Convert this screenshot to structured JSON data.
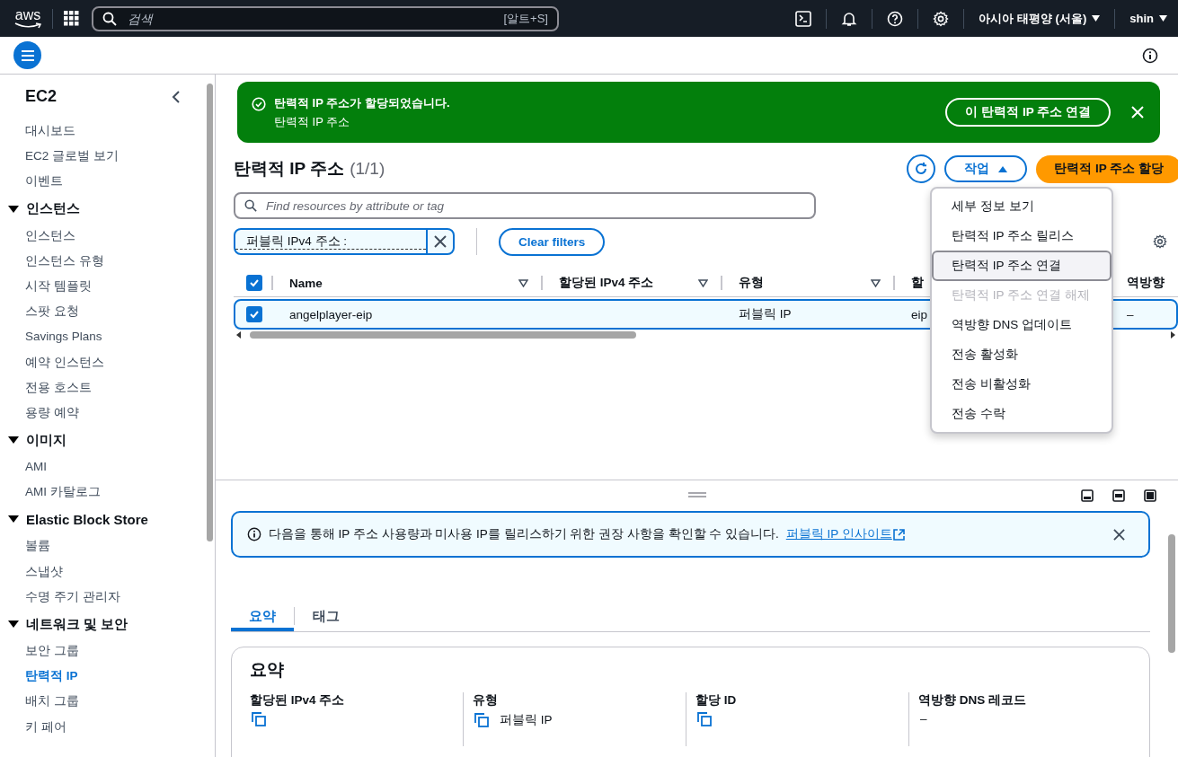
{
  "topnav": {
    "logo": "aws",
    "search": {
      "placeholder": "검색",
      "shortcut": "[알트+S]"
    },
    "region": "아시아 태평양 (서울)",
    "user": "shin"
  },
  "sidebar": {
    "title": "EC2",
    "items": [
      {
        "label": "대시보드",
        "selected": false
      },
      {
        "label": "EC2 글로벌 보기",
        "selected": false
      },
      {
        "label": "이벤트",
        "selected": false
      }
    ],
    "sections": [
      {
        "title": "인스턴스",
        "expanded": true,
        "items": [
          {
            "label": "인스턴스",
            "selected": false
          },
          {
            "label": "인스턴스 유형",
            "selected": false
          },
          {
            "label": "시작 템플릿",
            "selected": false
          },
          {
            "label": "스팟 요청",
            "selected": false
          },
          {
            "label": "Savings Plans",
            "selected": false
          },
          {
            "label": "예약 인스턴스",
            "selected": false
          },
          {
            "label": "전용 호스트",
            "selected": false
          },
          {
            "label": "용량 예약",
            "selected": false
          }
        ]
      },
      {
        "title": "이미지",
        "expanded": true,
        "items": [
          {
            "label": "AMI",
            "selected": false
          },
          {
            "label": "AMI 카탈로그",
            "selected": false
          }
        ]
      },
      {
        "title": "Elastic Block Store",
        "expanded": true,
        "items": [
          {
            "label": "볼륨",
            "selected": false
          },
          {
            "label": "스냅샷",
            "selected": false
          },
          {
            "label": "수명 주기 관리자",
            "selected": false
          }
        ]
      },
      {
        "title": "네트워크 및 보안",
        "expanded": true,
        "items": [
          {
            "label": "보안 그룹",
            "selected": false
          },
          {
            "label": "탄력적 IP",
            "selected": true
          },
          {
            "label": "배치 그룹",
            "selected": false
          },
          {
            "label": "키 페어",
            "selected": false
          }
        ]
      }
    ]
  },
  "flash": {
    "title": "탄력적 IP 주소가 할당되었습니다.",
    "message": "탄력적 IP 주소",
    "action": "이 탄력적 IP 주소 연결"
  },
  "header": {
    "title": "탄력적 IP 주소",
    "count": "(1/1)",
    "actions": {
      "label": "작업",
      "expanded": true
    },
    "primary": "탄력적 IP 주소 할당"
  },
  "filter": {
    "placeholder": "Find resources by attribute or tag",
    "token": "퍼블릭 IPv4 주소 :",
    "clear": "Clear filters"
  },
  "actions_menu": [
    {
      "label": "세부 정보 보기",
      "disabled": false,
      "selected": false
    },
    {
      "label": "탄력적 IP 주소 릴리스",
      "disabled": false,
      "selected": false
    },
    {
      "label": "탄력적 IP 주소 연결",
      "disabled": false,
      "selected": true
    },
    {
      "label": "탄력적 IP 주소 연결 해제",
      "disabled": true,
      "selected": false
    },
    {
      "label": "역방향 DNS 업데이트",
      "disabled": false,
      "selected": false
    },
    {
      "label": "전송 활성화",
      "disabled": false,
      "selected": false
    },
    {
      "label": "전송 비활성화",
      "disabled": false,
      "selected": false
    },
    {
      "label": "전송 수락",
      "disabled": false,
      "selected": false
    }
  ],
  "table": {
    "all_checked": true,
    "columns": [
      "Name",
      "할당된 IPv4 주소",
      "유형",
      "할",
      "역방향"
    ],
    "rows": [
      {
        "checked": true,
        "selected": true,
        "cells": [
          "angelplayer-eip",
          "",
          "퍼블릭 IP",
          "eip",
          "–"
        ]
      }
    ]
  },
  "info_alert": {
    "text": "다음을 통해 IP 주소 사용량과 미사용 IP를 릴리스하기 위한 권장 사항을 확인할 수 있습니다.",
    "link": "퍼블릭 IP 인사이트"
  },
  "tabs": [
    {
      "label": "요약",
      "selected": true
    },
    {
      "label": "태그",
      "selected": false
    }
  ],
  "summary": {
    "title": "요약",
    "fields": [
      {
        "label": "할당된 IPv4 주소",
        "kind": "copy"
      },
      {
        "label": "유형",
        "kind": "copy",
        "value": "퍼블릭 IP"
      },
      {
        "label": "할당 ID",
        "kind": "copy"
      },
      {
        "label": "역방향 DNS 레코드",
        "kind": "text",
        "value": "–"
      }
    ]
  }
}
